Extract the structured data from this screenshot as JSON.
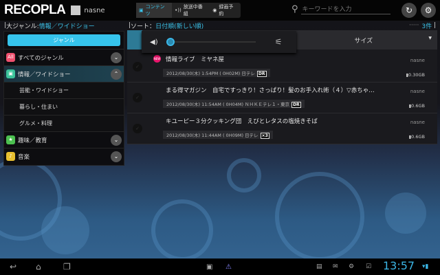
{
  "app": {
    "logo": "RECOPLA",
    "device": "nasne"
  },
  "modes": [
    {
      "label": "コンテンツ",
      "active": true
    },
    {
      "label": "放送中番組"
    },
    {
      "label": "録画予約"
    }
  ],
  "search": {
    "placeholder": "キーワードを入力"
  },
  "filter": {
    "label": "大ジャンル:",
    "value": "情報／ワイドショー"
  },
  "sort": {
    "label": "ソート：",
    "value": "日付順(新しい順)"
  },
  "count": "3件",
  "genre_button": "ジャンル",
  "genres": [
    {
      "icon": "All",
      "label": "すべてのジャンル",
      "color": "#f0506e"
    },
    {
      "icon": "tv",
      "label": "情報／ワイドショー",
      "color": "#3cc39a",
      "expanded": true,
      "children": [
        "芸能・ワイドショー",
        "暮らし・住まい",
        "グルメ・料理"
      ]
    },
    {
      "icon": "star",
      "label": "趣味／教育",
      "color": "#4cc050"
    },
    {
      "icon": "note",
      "label": "音楽",
      "color": "#e8c030"
    }
  ],
  "columns": {
    "size": "サイズ"
  },
  "volume": {
    "level": 0.05
  },
  "items": [
    {
      "title": "情報ライブ　ミヤネ屋",
      "meta": "2012/08/30(木) 1:54PM ( 0H02M) 日テレ",
      "tag": "DR",
      "source": "nasne",
      "size": "0.30GB",
      "new": true
    },
    {
      "title": "まる得マガジン　自宅ですっきり！さっぱり！髪のお手入れ術（４）▽赤ちゃ…",
      "meta": "2012/08/30(木) 11:54AM ( 0H04M) ＮＨＫＥテレ１・東京",
      "tag": "DR",
      "source": "nasne",
      "size": "0.6GB"
    },
    {
      "title": "キユーピー３分クッキング団　えびとレタスの塩焼きそば",
      "meta": "2012/08/30(木) 11:44AM ( 0H09M) 日テレ",
      "tag": "×3",
      "source": "nasne",
      "size": "0.6GB"
    }
  ],
  "status": {
    "time": "13:57"
  }
}
